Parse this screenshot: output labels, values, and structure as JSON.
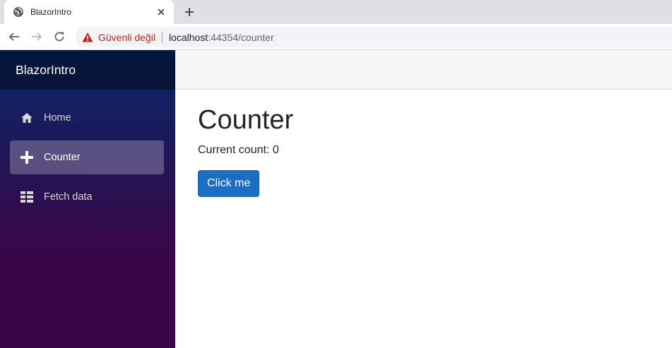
{
  "browser": {
    "tab_title": "BlazorIntro",
    "security_text": "Güvenli değil",
    "url_host": "localhost",
    "url_rest": ":44354/counter"
  },
  "app": {
    "brand": "BlazorIntro",
    "nav": [
      {
        "label": "Home",
        "icon": "home-icon",
        "active": false
      },
      {
        "label": "Counter",
        "icon": "plus-icon",
        "active": true
      },
      {
        "label": "Fetch data",
        "icon": "list-rich-icon",
        "active": false
      }
    ],
    "page_title": "Counter",
    "count_text": "Current count: 0",
    "button_label": "Click me"
  },
  "colors": {
    "accent": "#1b6ec2",
    "sidebar_top": "#052767",
    "sidebar_bottom": "#3a0647",
    "warning": "#c5221f"
  }
}
